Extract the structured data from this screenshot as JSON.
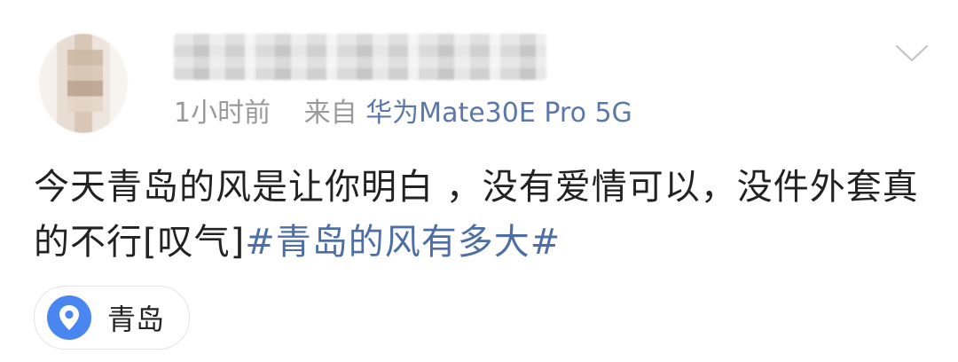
{
  "post": {
    "meta": {
      "time": "1小时前",
      "source_prefix": "来自",
      "device": "华为Mate30E Pro 5G"
    },
    "content": {
      "text": "今天青岛的风是让你明白 ，没有爱情可以，没件外套真的不行[叹气]",
      "hashtag": "#青岛的风有多大#"
    },
    "location": {
      "label": "青岛"
    }
  },
  "icons": {
    "more": "chevron-down-icon",
    "location": "location-pin-icon"
  },
  "colors": {
    "hashtag": "#4e6fa6",
    "device": "#5b78a8",
    "meta": "#9a9a9a",
    "pin": "#4a86f0"
  }
}
